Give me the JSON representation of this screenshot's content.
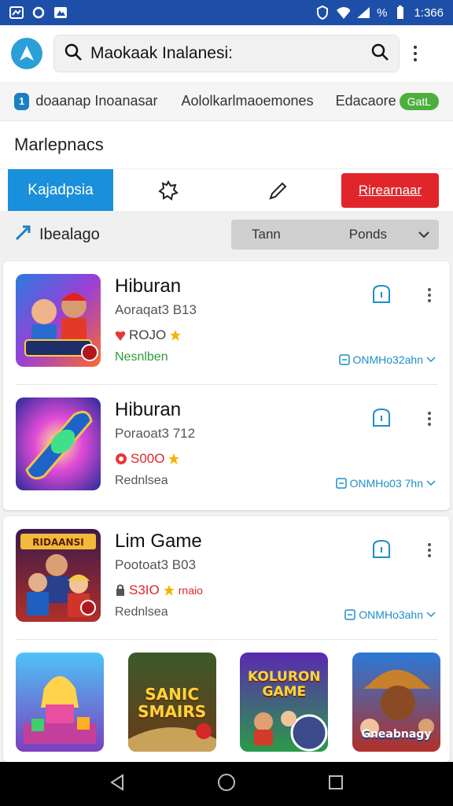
{
  "status_bar": {
    "time": "1:366",
    "battery": "%"
  },
  "search": {
    "query": "Maokaak Inalanesi:"
  },
  "categories": [
    {
      "badge": "1",
      "label": "doaanap Inoanasar"
    },
    {
      "label": "Aololkarlmaoemones"
    },
    {
      "label": "Edacaore",
      "pill": "GatL"
    }
  ],
  "section_title": "Marlepnacs",
  "tabs": {
    "active_label": "Kajadpsia",
    "red_label": "Rirearnaar"
  },
  "filter": {
    "label": "Ibealago",
    "sort_a": "Tann",
    "sort_b": "Ponds"
  },
  "apps": [
    {
      "title": "Hiburan",
      "sub": "Aoraqat3 B13",
      "rating": "ROJO",
      "status": "Nesnlben",
      "size": "ONMHo32ahn"
    },
    {
      "title": "Hiburan",
      "sub": "Poraoat3 712",
      "rating": "S00O",
      "status": "Rednlsea",
      "size": "ONMHo03 7hn"
    },
    {
      "title": "Lim Game",
      "sub": "Pootoat3 B03",
      "rating": "S3IO",
      "rating_extra": "rnaio",
      "status": "Rednlsea",
      "size": "ONMHo3ahn"
    }
  ],
  "thumbs": {
    "third": "RIDAANSI"
  },
  "grid_tiles": [
    {
      "label": ""
    },
    {
      "label": "SANIC SMAIRS"
    },
    {
      "label": "KOLURON GAME"
    },
    {
      "label": "Gneabnagy"
    }
  ],
  "colors": {
    "primary": "#1a8fdb",
    "red": "#e0262b",
    "status_bar": "#1e4fa8",
    "green": "#2e9a3a",
    "link": "#1d8ec8"
  }
}
